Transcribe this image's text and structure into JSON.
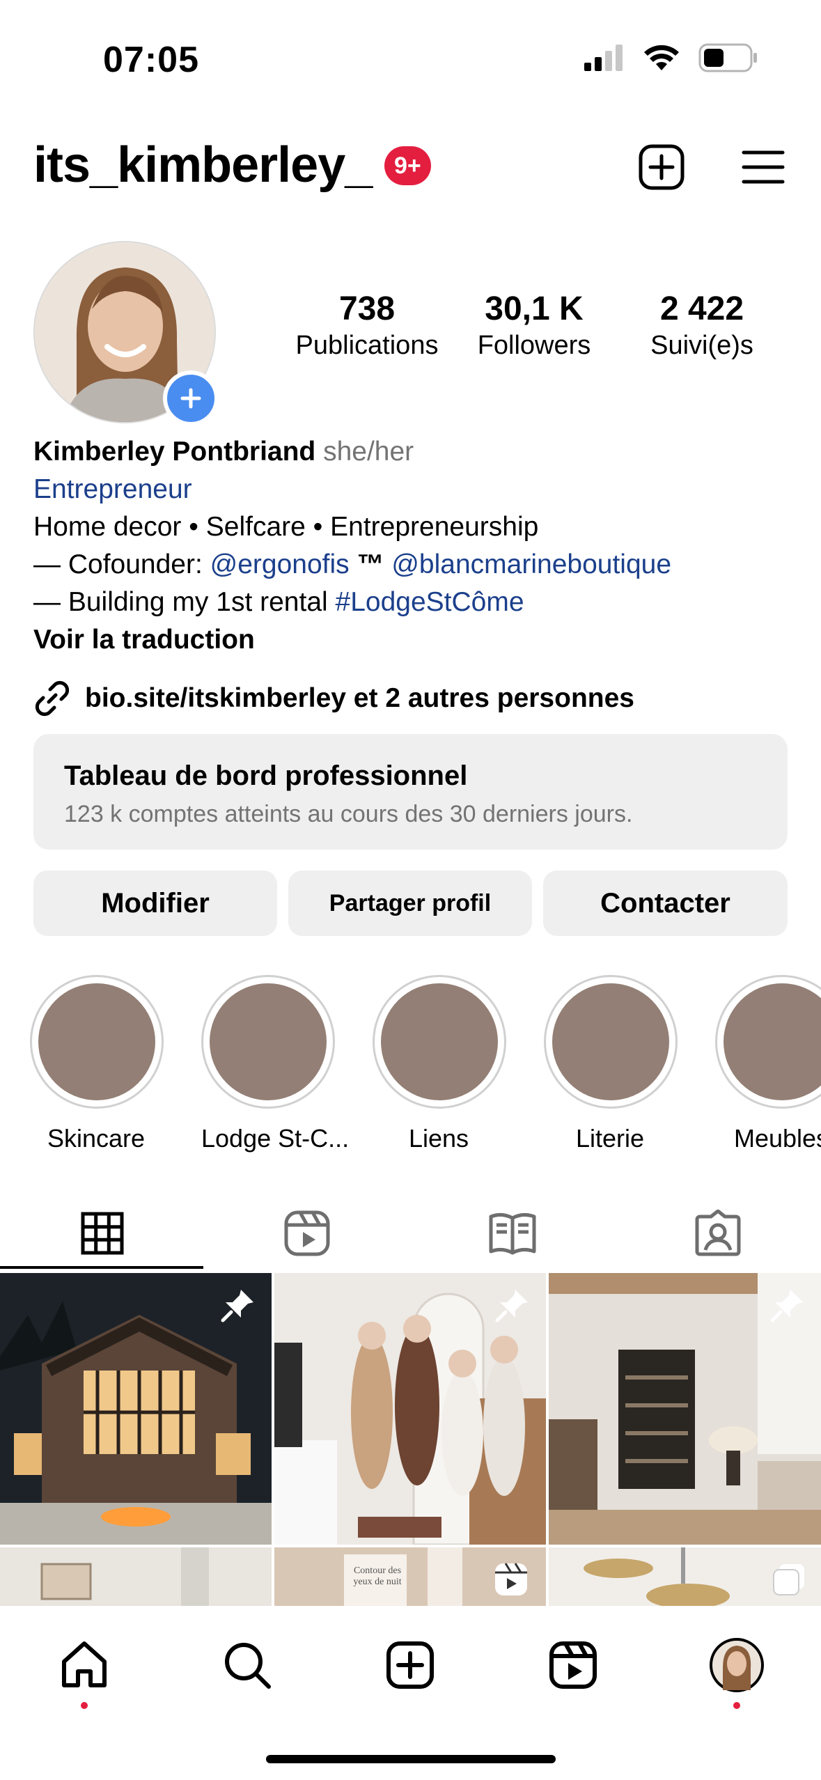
{
  "status_bar": {
    "time": "07:05"
  },
  "header": {
    "username": "its_kimberley_",
    "notification_badge": "9+"
  },
  "stats": [
    {
      "value": "738",
      "label": "Publications"
    },
    {
      "value": "30,1 K",
      "label": "Followers"
    },
    {
      "value": "2 422",
      "label": "Suivi(e)s"
    }
  ],
  "bio": {
    "name": "Kimberley Pontbriand",
    "pronouns": "she/her",
    "category": "Entrepreneur",
    "line1": "Home decor • Selfcare • Entrepreneurship",
    "line2_prefix": "— Cofounder: ",
    "line2_mention1": "@ergonofis",
    "line2_tm": " ™ ",
    "line2_mention2": "@blancmarineboutique",
    "line3_prefix": "— Building my 1st rental ",
    "line3_hashtag": "#LodgeStCôme",
    "translate": "Voir la traduction"
  },
  "link": {
    "text": "bio.site/itskimberley et 2 autres personnes"
  },
  "dashboard": {
    "title": "Tableau de bord professionnel",
    "subtitle": "123 k comptes atteints au cours des 30 derniers jours."
  },
  "actions": {
    "edit": "Modifier",
    "share": "Partager profil",
    "contact": "Contacter"
  },
  "highlights": [
    {
      "label": "Skincare"
    },
    {
      "label": "Lodge St-C..."
    },
    {
      "label": "Liens"
    },
    {
      "label": "Literie"
    },
    {
      "label": "Meubles"
    }
  ],
  "grid_overlay": {
    "post2_text": "Contour des yeux de nuit"
  },
  "colors": {
    "badge": "#e41e3f",
    "link": "#1b3f8b",
    "highlight_fill": "#937f75",
    "plus_button": "#4a8df0"
  },
  "tabs": [
    "grid-icon",
    "reels-icon",
    "guides-icon",
    "tagged-icon"
  ],
  "nav": [
    "home-icon",
    "search-icon",
    "create-icon",
    "reels-icon",
    "profile-avatar"
  ]
}
